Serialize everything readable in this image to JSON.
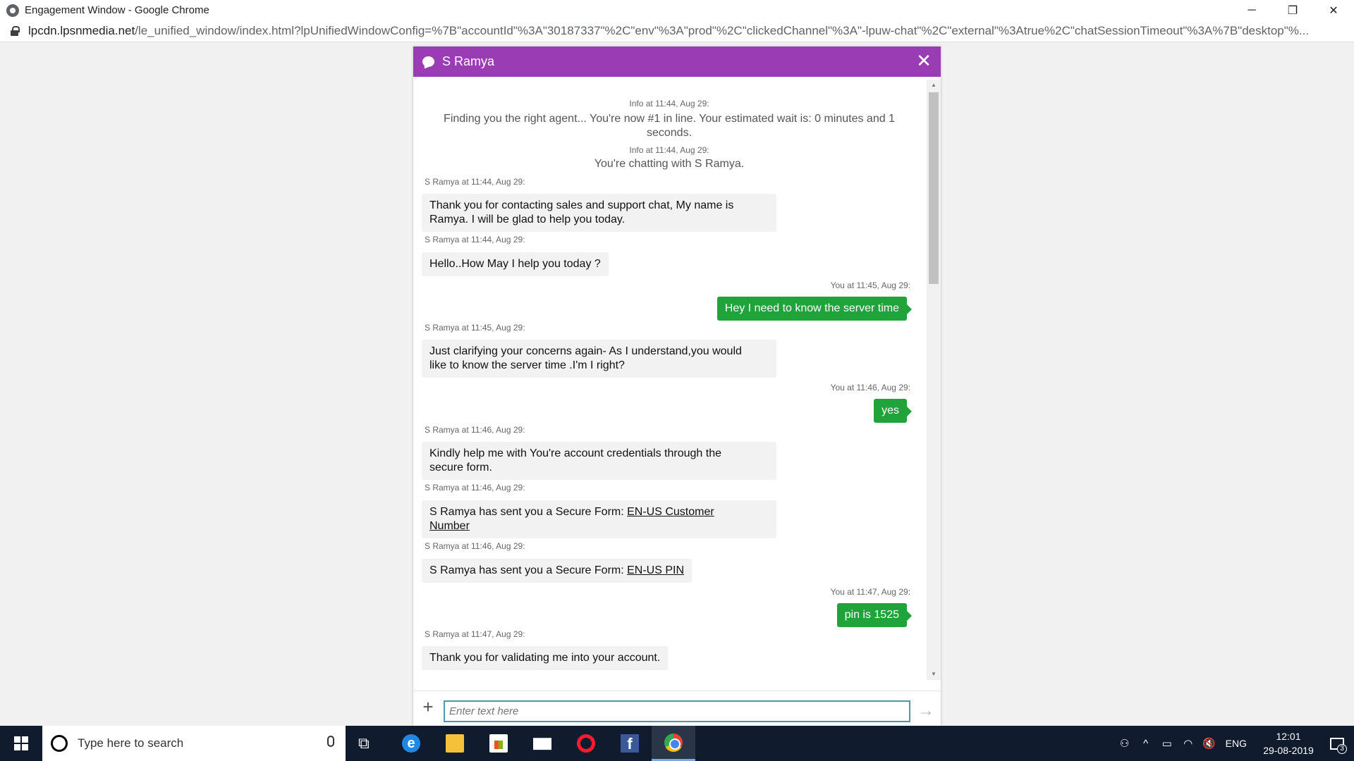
{
  "browser": {
    "window_title": "Engagement Window - Google Chrome",
    "minimize": "─",
    "restore": "❐",
    "close": "✕",
    "url_host": "lpcdn.lpsnmedia.net",
    "url_rest": "/le_unified_window/index.html?lpUnifiedWindowConfig=%7B\"accountId\"%3A\"30187337\"%2C\"env\"%3A\"prod\"%2C\"clickedChannel\"%3A\"-lpuw-chat\"%2C\"external\"%3Atrue%2C\"chatSessionTimeout\"%3A%7B\"desktop\"%..."
  },
  "chat": {
    "agent_name": "S Ramya",
    "close_label": "✕",
    "messages": {
      "info1_time": "Info at 11:44, Aug 29:",
      "info1_text": "Finding you the right agent... You're now #1 in line. Your estimated wait is: 0 minutes and 1 seconds.",
      "info2_time": "Info at 11:44, Aug 29:",
      "info2_text": "You're chatting with S Ramya.",
      "a1_time": "S Ramya at 11:44, Aug 29:",
      "a1_text_1": "Thank you for contacting sales and support chat, My name is",
      "a1_text_2": "Ramya. I will be glad to help you today.",
      "a2_time": "S Ramya at 11:44, Aug 29:",
      "a2_text": "Hello..How May I help you today ?",
      "u1_time": "You at 11:45, Aug 29:",
      "u1_text": "Hey I need to know the server time",
      "a3_time": "S Ramya at 11:45, Aug 29:",
      "a3_text_1": "Just clarifying your concerns again- As I understand,you would",
      "a3_text_2": "like to know the server time .I'm I right?",
      "u2_time": "You at 11:46, Aug 29:",
      "u2_text": "yes",
      "a4_time": "S Ramya at 11:46, Aug 29:",
      "a4_text_1": "Kindly help me with You're account credentials through the",
      "a4_text_2": "secure form.",
      "a5_time": "S Ramya at 11:46, Aug 29:",
      "a5_prefix": "S Ramya has sent you a Secure Form: ",
      "a5_link_1": "EN-US Customer",
      "a5_link_2": "Number",
      "a6_time": "S Ramya at 11:46, Aug 29:",
      "a6_prefix": "S Ramya has sent you a Secure Form: ",
      "a6_link": "EN-US PIN",
      "u3_time": "You at 11:47, Aug 29:",
      "u3_text": "pin is 1525",
      "a7_time": "S Ramya at 11:47, Aug 29:",
      "a7_text": "Thank you for validating me into your account."
    },
    "input_placeholder": "Enter text here",
    "plus_label": "+",
    "send_label": "→"
  },
  "taskbar": {
    "search_placeholder": "Type here to search",
    "lang": "ENG",
    "time": "12:01",
    "date": "29-08-2019",
    "notification_count": "3",
    "taskview_glyph": "⧉",
    "edge_glyph": "e",
    "facebook_glyph": "f",
    "tray_people_glyph": "⚇",
    "tray_chevron_glyph": "^",
    "tray_battery_glyph": "▭",
    "tray_wifi_glyph": "◠",
    "tray_volume_glyph": "🔇"
  },
  "colors": {
    "header": "#9a3db5",
    "user_bubble": "#1fa33a",
    "agent_bubble": "#f2f2f2",
    "taskbar": "#101b2e"
  }
}
